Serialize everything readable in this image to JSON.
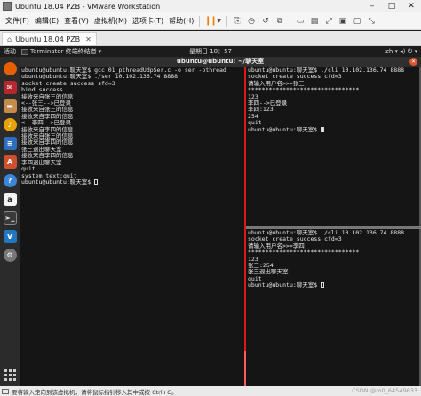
{
  "window": {
    "title": "Ubuntu 18.04 PZB - VMware Workstation"
  },
  "menu": {
    "file": "文件(F)",
    "edit": "编辑(E)",
    "view": "查看(V)",
    "vm": "虚拟机(M)",
    "tabs": "选项卡(T)",
    "help": "帮助(H)"
  },
  "vm_tab": {
    "label": "Ubuntu 18.04 PZB"
  },
  "topbar": {
    "activities": "活动",
    "app_name": "Terminator 终端终结者",
    "app_dropdown": "▾",
    "clock": "星期日 18：57",
    "sys": "zh ▾   ◂)  ⏻ ▾"
  },
  "terminal": {
    "title": "ubuntu@ubuntu: ~/聊天室",
    "left_pane": [
      "ubuntu@ubuntu:聊天室$ gcc 01_pthreadUdpSer.c -o ser -pthread",
      "ubuntu@ubuntu:聊天室$ ./ser 10.102.136.74 8888",
      "socket create success sfd=3",
      "bind success",
      "接收来自张三的信息",
      "<--张三-->已登录",
      "接收来自张三的信息",
      "接收来自李四的信息",
      "<--李四-->已登录",
      "接收来自李四的信息",
      "接收来自张三的信息",
      "接收来自李四的信息",
      "张三退出聊天室",
      "接收来自李四的信息",
      "李四退出聊天室",
      "quit",
      "system text:quit",
      "ubuntu@ubuntu:聊天室$ "
    ],
    "right_top_pane": [
      "ubuntu@ubuntu:聊天室$ ./cli 10.102.136.74 8888",
      "socket create success cfd=3",
      "请输入用户名>>>张三",
      "********************************",
      "123",
      "李四-->已登录",
      "李四:123",
      "254",
      "quit",
      "ubuntu@ubuntu:聊天室$ "
    ],
    "right_bottom_pane": [
      "ubuntu@ubuntu:聊天室$ ./cli 10.102.136.74 8888",
      "socket create success cfd=3",
      "请输入用户名>>>李四",
      "********************************",
      "123",
      "张三:254",
      "张三退出聊天室",
      "quit",
      "ubuntu@ubuntu:聊天室$ "
    ]
  },
  "status": {
    "hint": "要将输入定向到该虚拟机，请将鼠标指针移入其中或按 Ctrl+G。",
    "watermark": "CSDN @m0_64549633"
  },
  "colors": {
    "split_active": "#e01515",
    "pause_accent": "#f08000"
  }
}
